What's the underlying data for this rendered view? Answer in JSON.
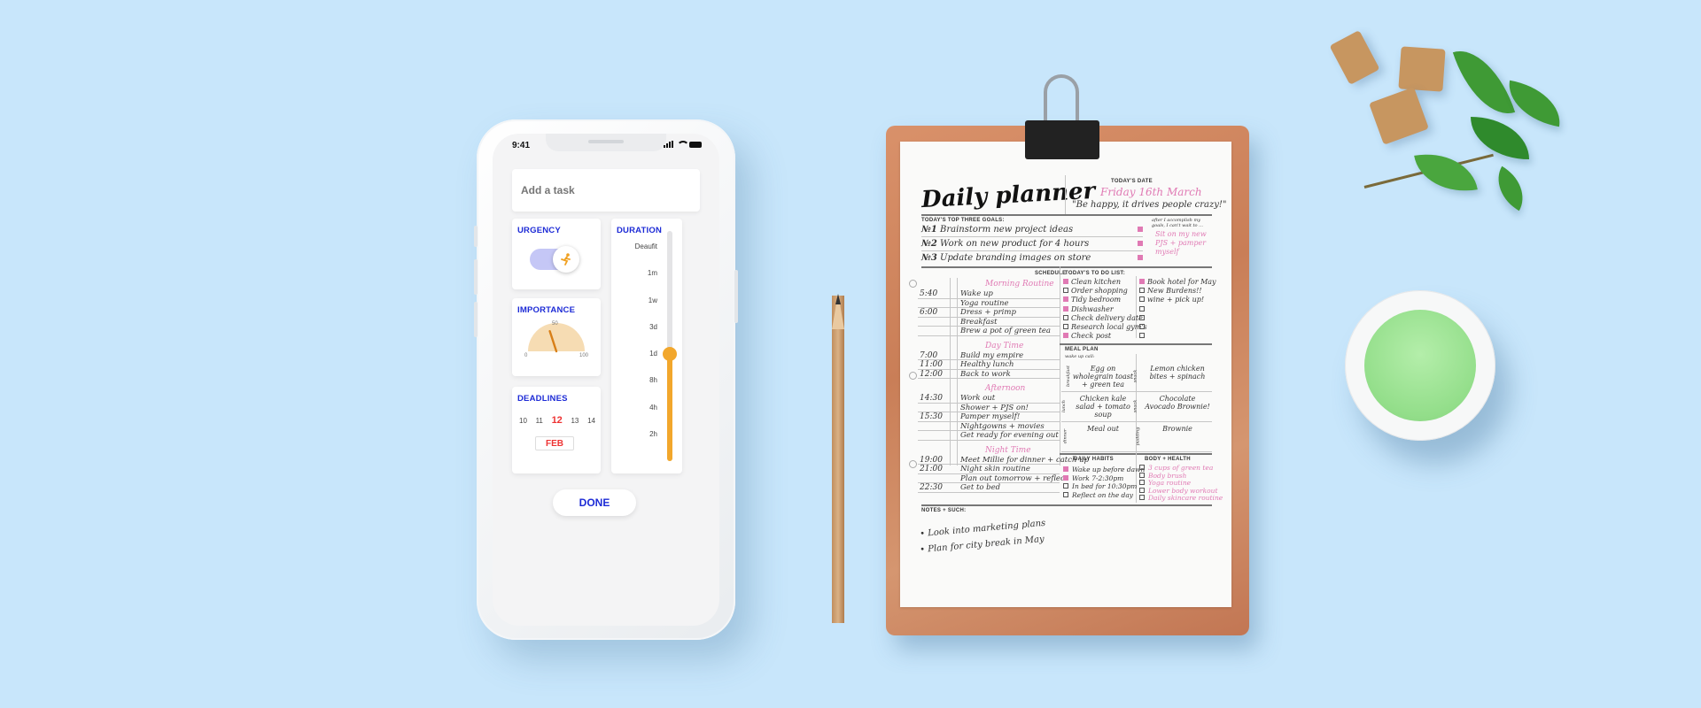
{
  "phone": {
    "status_time": "9:41",
    "add_task_placeholder": "Add a task",
    "urgency": {
      "title": "URGENCY",
      "icon": "running-person-icon",
      "toggle_on": true
    },
    "importance": {
      "title": "IMPORTANCE",
      "min": "0",
      "mid": "50",
      "max": "100",
      "value": 40
    },
    "deadlines": {
      "title": "DEADLINES",
      "dates": [
        "10",
        "11",
        "12",
        "13",
        "14"
      ],
      "selected": "12",
      "month": "FEB"
    },
    "duration": {
      "title": "DURATION",
      "options": [
        "Deaufit",
        "1m",
        "1w",
        "3d",
        "1d",
        "8h",
        "4h",
        "2h"
      ],
      "selected": "1d"
    },
    "done_label": "DONE",
    "accent_color": "#1d2bd6",
    "slider_color": "#f2a72c"
  },
  "planner": {
    "title": "Daily planner",
    "date_label": "TODAY'S DATE",
    "date": "Friday 16th March",
    "quote": "\"Be happy, it drives people crazy!\"",
    "goals_label": "TODAY'S TOP THREE GOALS:",
    "goals": [
      {
        "num": "№1",
        "text": "Brainstorm new project ideas"
      },
      {
        "num": "№2",
        "text": "Work on new product for 4 hours"
      },
      {
        "num": "№3",
        "text": "Update branding images on store"
      }
    ],
    "reward_label": "after I accomplish my goals, I can't wait to ...",
    "reward": "Sit on my new PJS + pamper myself",
    "schedule_label": "SCHEDULE",
    "schedule": [
      {
        "header": "Morning Routine",
        "rows": [
          {
            "time": "5:40",
            "text": "Wake up"
          },
          {
            "time": "",
            "text": "Yoga routine"
          },
          {
            "time": "6:00",
            "text": "Dress + primp"
          },
          {
            "time": "",
            "text": "Breakfast"
          },
          {
            "time": "",
            "text": "Brew a pot of green tea"
          }
        ]
      },
      {
        "header": "Day Time",
        "rows": [
          {
            "time": "7:00",
            "text": "Build my empire"
          },
          {
            "time": "11:00",
            "text": "Healthy lunch"
          },
          {
            "time": "12:00",
            "text": "Back to work"
          }
        ]
      },
      {
        "header": "Afternoon",
        "rows": [
          {
            "time": "14:30",
            "text": "Work out"
          },
          {
            "time": "",
            "text": "Shower + PJS on!"
          },
          {
            "time": "15:30",
            "text": "Pamper myself!"
          },
          {
            "time": "",
            "text": "Nightgowns + movies"
          },
          {
            "time": "",
            "text": "Get ready for evening out"
          }
        ]
      },
      {
        "header": "Night Time",
        "rows": [
          {
            "time": "19:00",
            "text": "Meet Millie for dinner + catch up"
          },
          {
            "time": "21:00",
            "text": "Night skin routine"
          },
          {
            "time": "",
            "text": "Plan out tomorrow + reflect"
          },
          {
            "time": "22:30",
            "text": "Get to bed"
          }
        ]
      }
    ],
    "todo_label": "TODAY'S TO DO LIST:",
    "todo_left": [
      {
        "text": "Clean kitchen",
        "done": true
      },
      {
        "text": "Order shopping",
        "done": false
      },
      {
        "text": "Tidy bedroom",
        "done": true
      },
      {
        "text": "Dishwasher",
        "done": true
      },
      {
        "text": "Check delivery date",
        "done": false
      },
      {
        "text": "Research local gym's",
        "done": false
      },
      {
        "text": "Check post",
        "done": true
      }
    ],
    "todo_right": [
      {
        "text": "Book hotel for May",
        "done": true
      },
      {
        "text": "New Burdens!!",
        "done": false
      },
      {
        "text": "wine + pick up!",
        "done": false
      }
    ],
    "meal_label": "MEAL PLAN",
    "meal_sub": "wake up call:",
    "meals": [
      {
        "slot": "breakfast",
        "text": "Egg on wholegrain toast + green tea",
        "slot2": "snack",
        "text2": "Lemon chicken bites + spinach"
      },
      {
        "slot": "lunch",
        "text": "Chicken kale salad + tomato soup",
        "slot2": "snack",
        "text2": "Chocolate Avocado Brownie!"
      },
      {
        "slot": "dinner",
        "text": "Meal out",
        "slot2": "pudding",
        "text2": "Brownie"
      }
    ],
    "habits_label": "DAILY HABITS",
    "habits": [
      "Wake up before dawn",
      "Work 7-2:30pm",
      "In bed for 10:30pm",
      "Reflect on the day"
    ],
    "health_label": "BODY + HEALTH",
    "health": [
      "3 cups of green tea",
      "Body brush",
      "Yoga routine",
      "Lower body workout",
      "Daily skincare routine"
    ],
    "notes_label": "NOTES + SUCH:",
    "notes": [
      "• Look into marketing plans",
      "• Plan for city break in May"
    ]
  }
}
